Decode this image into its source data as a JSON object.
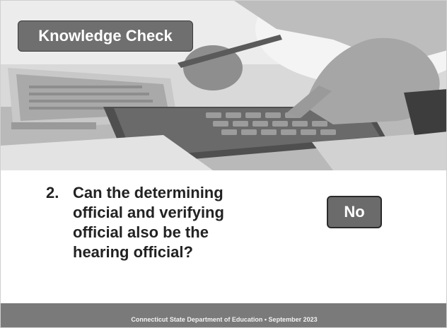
{
  "slide": {
    "title": "Knowledge Check",
    "question_number": "2.",
    "question_text": "Can the determining official and verifying official also be the hearing official?",
    "answer": "No",
    "footer": "Connecticut State Department of Education • September 2023",
    "background_image": "photo-of-hands-using-calculator-and-laptop"
  }
}
